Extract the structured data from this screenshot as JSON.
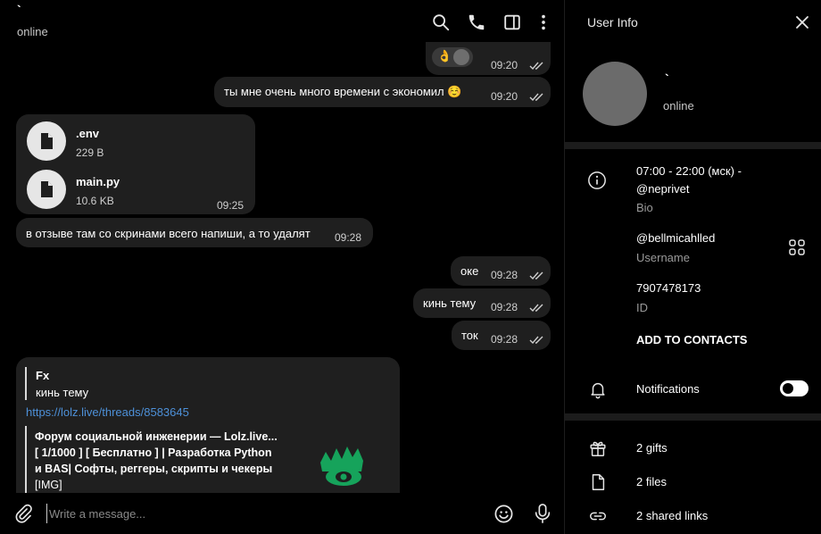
{
  "chat": {
    "name": "`",
    "status": "online",
    "messages": {
      "m1_emoji": "👌",
      "m1_time": "09:20",
      "m2_text": "ты мне очень много времени с экономил ☺️",
      "m2_time": "09:20",
      "file1_name": ".env",
      "file1_size": "229 B",
      "file2_name": "main.py",
      "file2_size": "10.6 KB",
      "files_time": "09:25",
      "m3_text": "в отзыве там со скринами всего напиши, а то удалят",
      "m3_time": "09:28",
      "m4_text": "оке",
      "m4_time": "09:28",
      "m5_text": "кинь тему",
      "m5_time": "09:28",
      "m6_text": "ток",
      "m6_time": "09:28",
      "reply_author": "Fx",
      "reply_text": "кинь тему",
      "link": "https://lolz.live/threads/8583645",
      "preview_line1": "Форум социальной инженерии —  Lolz.live...",
      "preview_line2": "[ 1/1000  ] [ Бесплатно ] | Разработка Python",
      "preview_line3": "и BAS| Софты, реггеры, скрипты и чекеры",
      "preview_line4": "[IMG]"
    },
    "composer_placeholder": "Write a message..."
  },
  "info": {
    "title": "User Info",
    "name": "`",
    "status": "online",
    "bio_line1": "07:00 - 22:00 (мск) -",
    "bio_line2": "@neprivet",
    "bio_label": "Bio",
    "username": "@bellmicahlled",
    "username_label": "Username",
    "id": "7907478173",
    "id_label": "ID",
    "add_contacts": "ADD TO CONTACTS",
    "notifications": "Notifications",
    "notifications_on": false,
    "gifts": "2 gifts",
    "files": "2 files",
    "links": "2 shared links"
  },
  "colors": {
    "bubble": "#1f1f1f",
    "link": "#4d90d8",
    "avatar": "#6b6b6b",
    "separator": "#1c1c1c"
  },
  "icons": [
    "search-icon",
    "phone-icon",
    "sidebar-toggle-icon",
    "more-vert-icon",
    "close-icon",
    "info-icon",
    "qr-code-icon",
    "bell-icon",
    "gift-icon",
    "file-icon",
    "link-icon",
    "attach-icon",
    "emoji-icon",
    "mic-icon",
    "document-icon",
    "double-check-icon"
  ]
}
